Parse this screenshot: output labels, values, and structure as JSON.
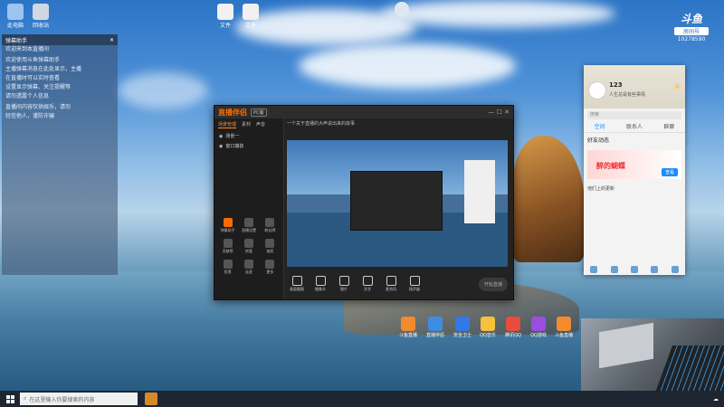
{
  "desktop_icons": [
    {
      "label": "此电脑",
      "icon": "computer-icon",
      "color": "#9cc4ee"
    },
    {
      "label": "回收站",
      "icon": "recycle-bin-icon",
      "color": "#cfd8e2"
    },
    {
      "label": "文件",
      "icon": "file-icon",
      "color": "#f1f1f1"
    },
    {
      "label": "文件",
      "icon": "file-icon",
      "color": "#f1f1f1"
    }
  ],
  "chat_panel": {
    "title": "弹幕助手",
    "lines": [
      "欢迎来到本直播间",
      "",
      "欢迎使用斗鱼弹幕助手",
      "主播弹幕消息在此处显示，主播",
      "在直播时可以实时查看",
      "设置显示弹幕、关注提醒等",
      "请勿透露个人信息",
      "",
      "直播间内容仅供娱乐，请勿",
      "轻信他人，谨防诈骗"
    ]
  },
  "streaming_app": {
    "logo": "直播伴侣",
    "version_tag": "PC版",
    "tabs": [
      "场景管理",
      "素材",
      "声音"
    ],
    "active_tab": "场景管理",
    "scene_items": [
      "场景一",
      "窗口捕获"
    ],
    "info_text": "一个关于直播的大声说出来的故事",
    "tools": [
      {
        "label": "弹幕助手",
        "icon": "danmu-icon"
      },
      {
        "label": "直播设置",
        "icon": "settings-icon"
      },
      {
        "label": "粉丝牌",
        "icon": "badge-icon"
      },
      {
        "label": "贡献榜",
        "icon": "rank-icon"
      },
      {
        "label": "房管",
        "icon": "admin-icon"
      },
      {
        "label": "抽奖",
        "icon": "gift-icon"
      },
      {
        "label": "投票",
        "icon": "vote-icon"
      },
      {
        "label": "连麦",
        "icon": "link-icon"
      },
      {
        "label": "更多",
        "icon": "more-icon"
      }
    ],
    "bottom_tools": [
      {
        "label": "画面截图",
        "icon": "screenshot-icon"
      },
      {
        "label": "摄像头",
        "icon": "camera-icon"
      },
      {
        "label": "图片",
        "icon": "image-icon"
      },
      {
        "label": "文字",
        "icon": "text-icon"
      },
      {
        "label": "麦克风",
        "icon": "mic-icon"
      },
      {
        "label": "扬声器",
        "icon": "speaker-icon"
      }
    ],
    "start_label": "开始直播"
  },
  "qq_panel": {
    "name": "123",
    "signature": "人生总是有些事情",
    "search_placeholder": "搜索",
    "tabs": [
      "空间",
      "联系人",
      "群聊"
    ],
    "active_tab": "空间",
    "feed_title": "好友动态",
    "banner_text": "醉的蝴蝶",
    "banner_button": "查看",
    "bottom_note": "他们上的更新"
  },
  "douyu": {
    "brand": "斗鱼",
    "room_label": "房间号",
    "room_number": "10278590"
  },
  "taskbar_apps": [
    {
      "label": "斗鱼直播",
      "color": "#f28a2e"
    },
    {
      "label": "直播伴侣",
      "color": "#3c8de0"
    },
    {
      "label": "安全卫士",
      "color": "#3179e6"
    },
    {
      "label": "QQ音乐",
      "color": "#f4c23b"
    },
    {
      "label": "腾讯QQ",
      "color": "#e84c3c"
    },
    {
      "label": "QQ游戏",
      "color": "#9b4de0"
    },
    {
      "label": "斗鱼直播",
      "color": "#f28a2e"
    }
  ],
  "taskbar": {
    "search_placeholder": "在这里输入你要搜索的内容"
  }
}
